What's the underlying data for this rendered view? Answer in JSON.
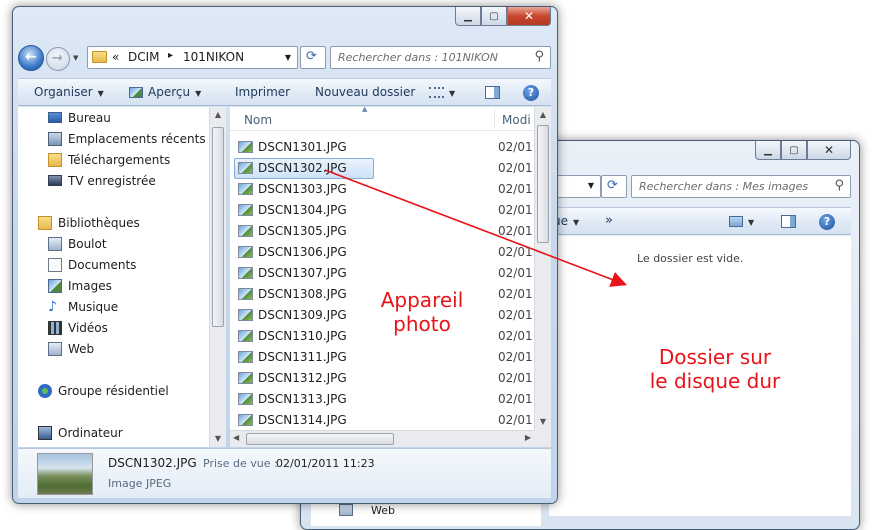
{
  "front_window": {
    "address_crumbs": [
      "«",
      "DCIM",
      "▸",
      "101NIKON"
    ],
    "search_placeholder": "Rechercher dans : 101NIKON",
    "toolbar": {
      "organize": "Organiser",
      "preview": "Aperçu",
      "print": "Imprimer",
      "new_folder": "Nouveau dossier"
    },
    "column_name": "Nom",
    "column_date": "Modi",
    "nav_groups": [
      {
        "items": [
          "Bureau",
          "Emplacements récents",
          "Téléchargements",
          "TV enregistrée"
        ]
      },
      {
        "header": "Bibliothèques",
        "items": [
          "Boulot",
          "Documents",
          "Images",
          "Musique",
          "Vidéos",
          "Web"
        ]
      },
      {
        "header": "Groupe résidentiel"
      },
      {
        "header": "Ordinateur"
      }
    ],
    "files": [
      {
        "name": "DSCN1301.JPG",
        "date": "02/01"
      },
      {
        "name": "DSCN1302.JPG",
        "date": "02/01"
      },
      {
        "name": "DSCN1303.JPG",
        "date": "02/01"
      },
      {
        "name": "DSCN1304.JPG",
        "date": "02/01"
      },
      {
        "name": "DSCN1305.JPG",
        "date": "02/01"
      },
      {
        "name": "DSCN1306.JPG",
        "date": "02/01"
      },
      {
        "name": "DSCN1307.JPG",
        "date": "02/01"
      },
      {
        "name": "DSCN1308.JPG",
        "date": "02/01"
      },
      {
        "name": "DSCN1309.JPG",
        "date": "02/01"
      },
      {
        "name": "DSCN1310.JPG",
        "date": "02/01"
      },
      {
        "name": "DSCN1311.JPG",
        "date": "02/01"
      },
      {
        "name": "DSCN1312.JPG",
        "date": "02/01"
      },
      {
        "name": "DSCN1313.JPG",
        "date": "02/01"
      },
      {
        "name": "DSCN1314.JPG",
        "date": "02/01"
      }
    ],
    "selected_file": "DSCN1302.JPG",
    "details": {
      "filename": "DSCN1302.JPG",
      "date_label": "Prise de vue :",
      "date_value": "02/01/2011 11:23",
      "type": "Image JPEG"
    }
  },
  "back_window": {
    "search_placeholder": "Rechercher dans : Mes images",
    "toolbar_partial": "ue",
    "toolbar_more": "»",
    "empty_message": "Le dossier est vide.",
    "nav_partial_item": "Web"
  },
  "annotations": {
    "camera": "Appareil\nphoto",
    "disk": "Dossier sur\nle disque dur",
    "color": "#e8141a"
  },
  "icons": [
    "back-icon",
    "forward-icon",
    "folder-icon",
    "refresh-icon",
    "search-icon",
    "minimize-icon",
    "maximize-icon",
    "close-icon",
    "view-icon",
    "preview-pane-icon",
    "help-icon"
  ]
}
